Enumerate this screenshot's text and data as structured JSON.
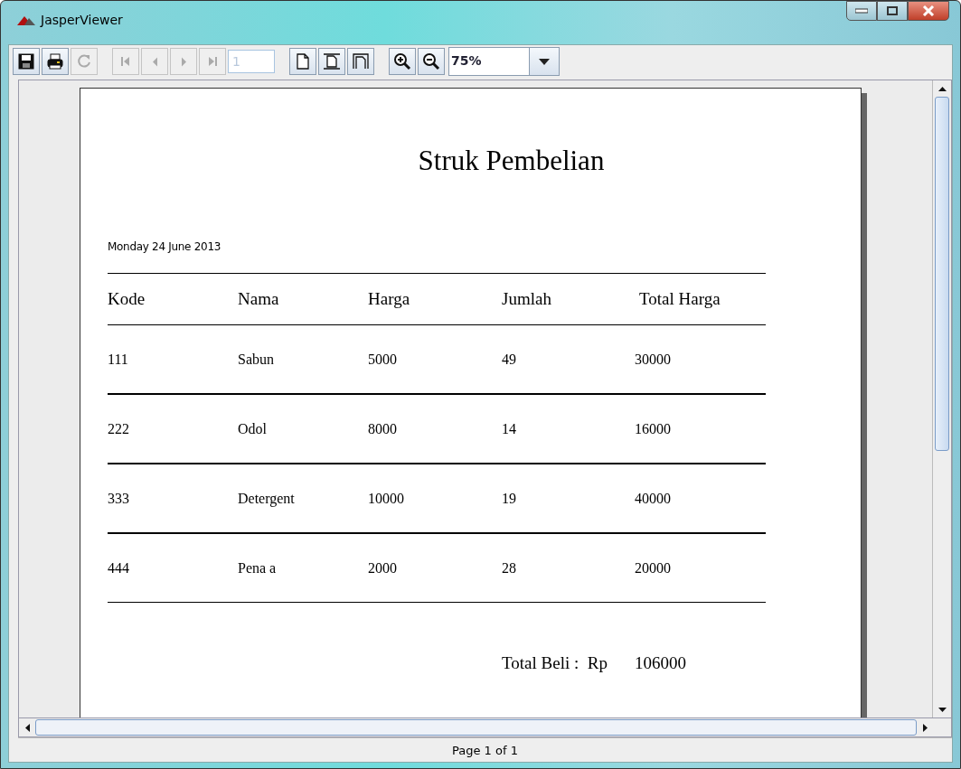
{
  "window": {
    "title": "JasperViewer"
  },
  "toolbar": [
    {
      "kind": "save",
      "disabled": false
    },
    {
      "kind": "print",
      "disabled": false
    },
    {
      "kind": "reload",
      "disabled": true
    },
    {
      "kind": "gap"
    },
    {
      "kind": "first",
      "disabled": true
    },
    {
      "kind": "prev",
      "disabled": true
    },
    {
      "kind": "next",
      "disabled": true
    },
    {
      "kind": "last",
      "disabled": true
    },
    {
      "kind": "page-field",
      "value": "1",
      "disabled": true
    },
    {
      "kind": "gap"
    },
    {
      "kind": "actual-size",
      "disabled": false
    },
    {
      "kind": "fit-page",
      "disabled": false
    },
    {
      "kind": "fit-width",
      "disabled": false
    },
    {
      "kind": "gap"
    },
    {
      "kind": "zoom-in",
      "disabled": false
    },
    {
      "kind": "zoom-out",
      "disabled": false
    },
    {
      "kind": "zoom-combo",
      "value": "75%",
      "disabled": false
    }
  ],
  "report": {
    "title": "Struk Pembelian",
    "date": "Monday 24 June 2013",
    "columns": [
      "Kode",
      "Nama",
      "Harga",
      "Jumlah",
      "Total Harga"
    ],
    "rows": [
      [
        "111",
        "Sabun",
        "5000",
        "49",
        "30000"
      ],
      [
        "222",
        "Odol",
        "8000",
        "14",
        "16000"
      ],
      [
        "333",
        "Detergent",
        "10000",
        "19",
        "40000"
      ],
      [
        "444",
        "Pena a",
        "2000",
        "28",
        "20000"
      ]
    ],
    "total_label": "Total Beli :  Rp",
    "total_value": "106000"
  },
  "status_bar": "Page 1 of 1"
}
